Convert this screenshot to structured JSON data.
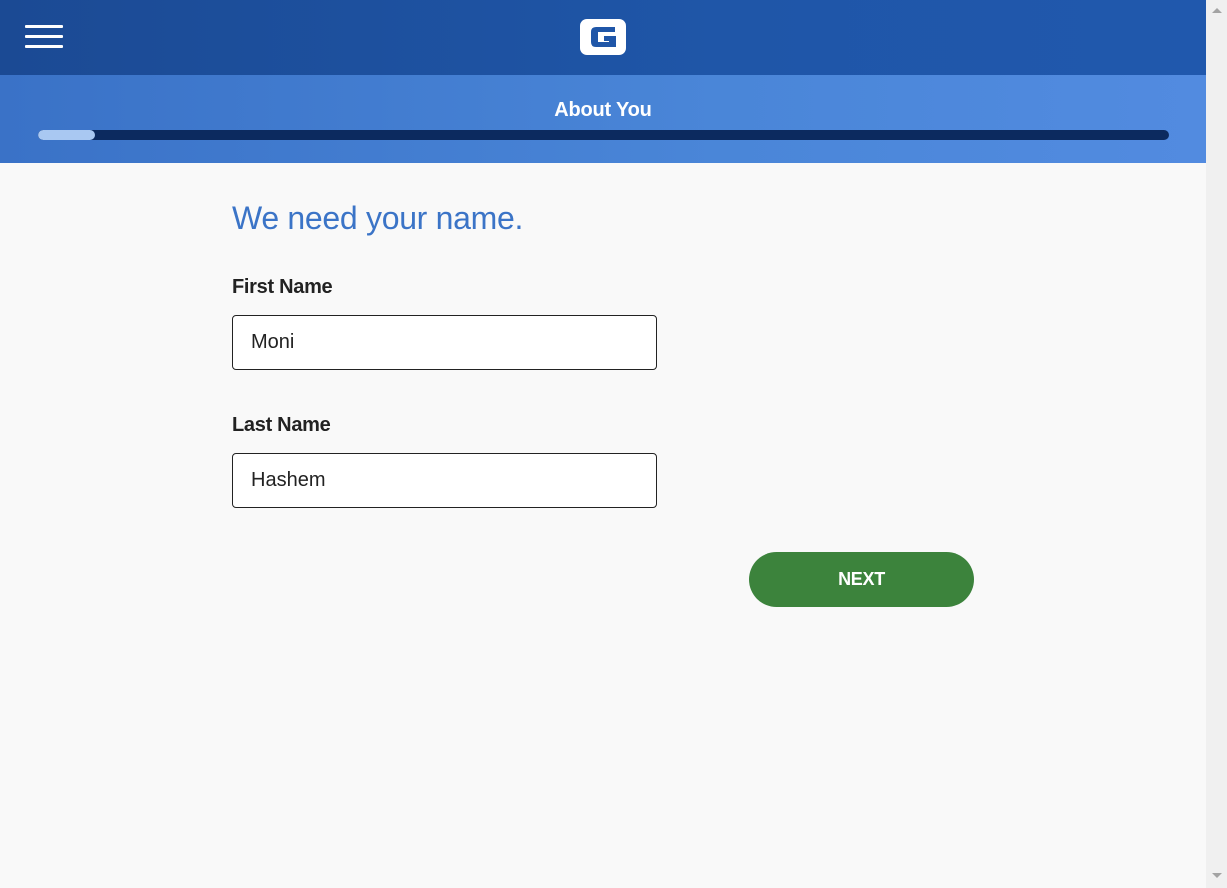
{
  "header": {
    "menu_icon": "hamburger-menu-icon",
    "logo_letter": "G",
    "logo_icon": "brand-logo-icon"
  },
  "progress": {
    "title": "About You",
    "percent": 5,
    "colors": {
      "fill": "#a9c8f2",
      "track": "#0c2a5f"
    }
  },
  "form": {
    "heading": "We need your name.",
    "first_name": {
      "label": "First Name",
      "value": "Moni"
    },
    "last_name": {
      "label": "Last Name",
      "value": "Hashem"
    },
    "next_label": "NEXT"
  },
  "colors": {
    "header": "#1f56a8",
    "heading": "#3b74c7",
    "button": "#3c833c"
  },
  "scrollbar": {
    "up_icon": "scroll-up-arrow-icon",
    "down_icon": "scroll-down-arrow-icon"
  }
}
